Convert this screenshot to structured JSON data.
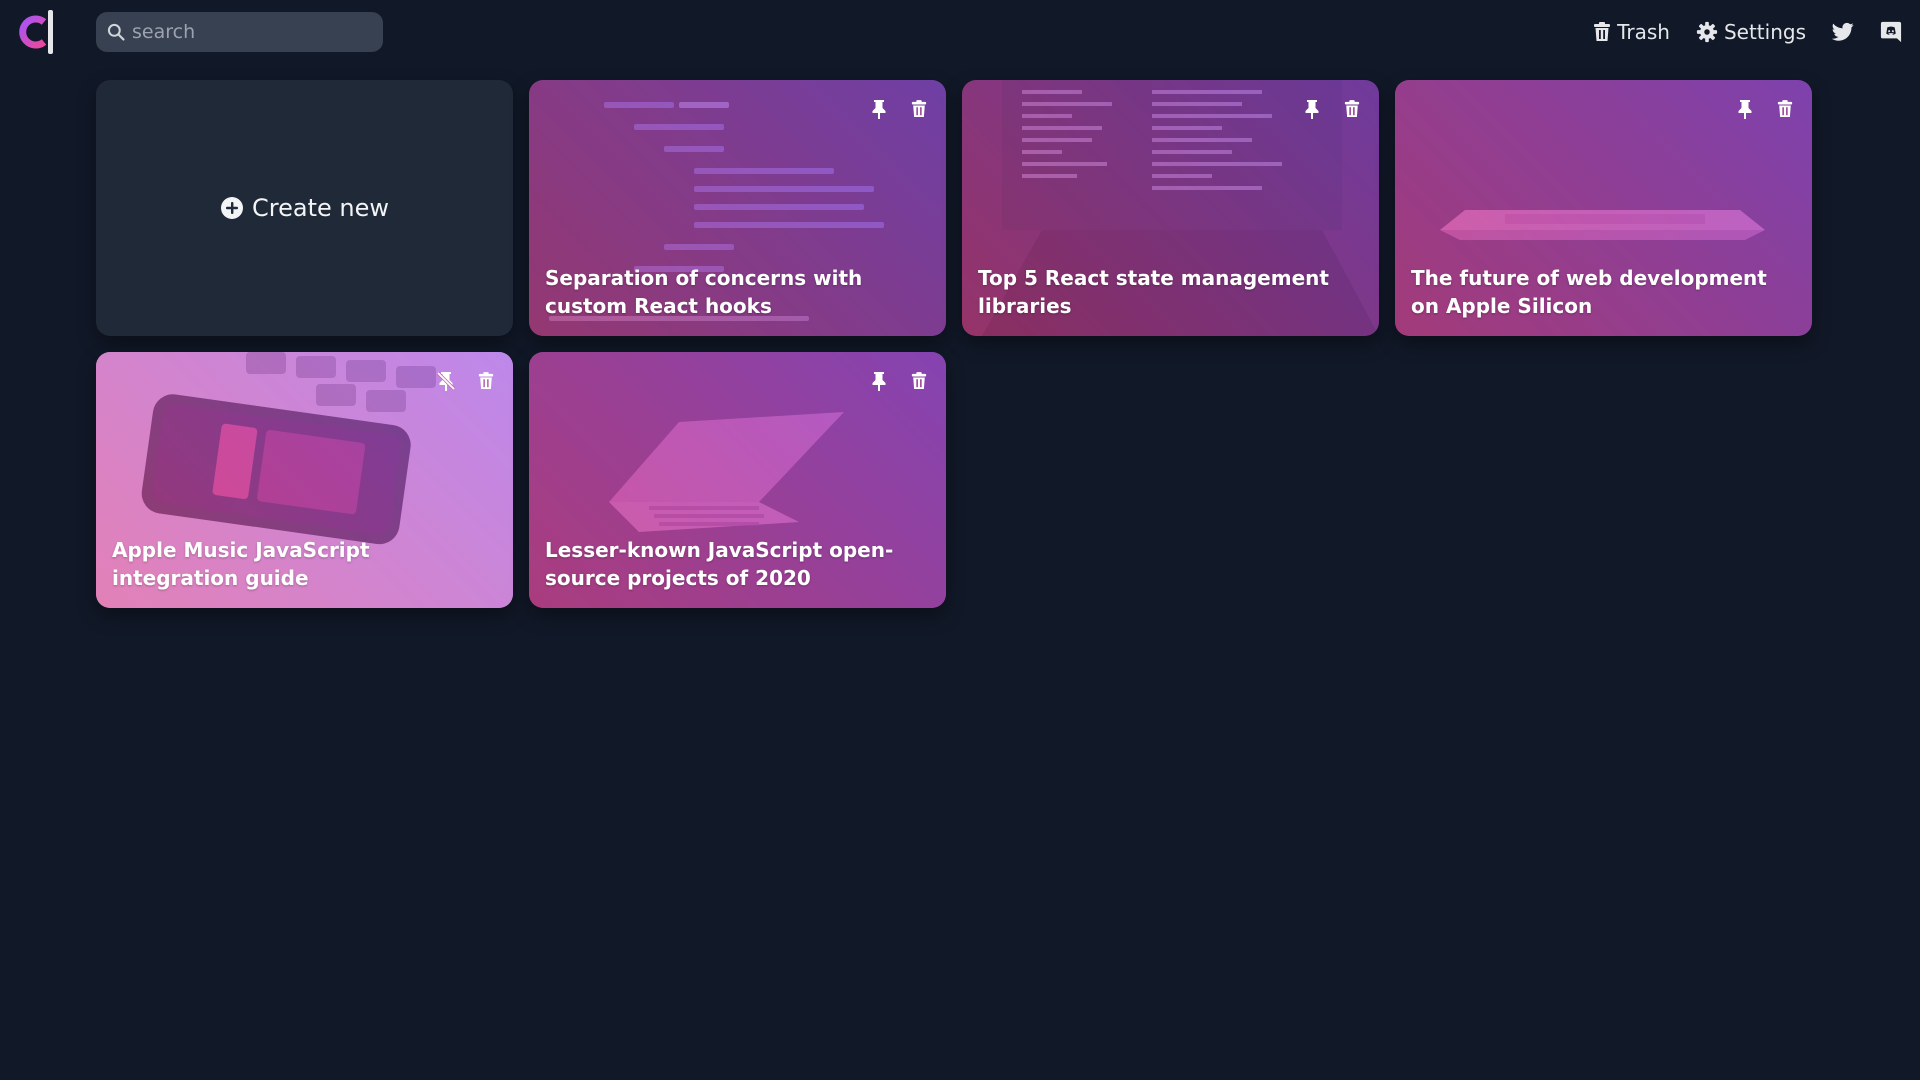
{
  "app": {
    "logo_icon": "c-logo-icon",
    "accent_pink": "#ec4899",
    "accent_purple": "#a855f7",
    "background": "#111827"
  },
  "search": {
    "placeholder": "search",
    "value": "",
    "icon": "search-icon"
  },
  "nav": {
    "trash_label": "Trash",
    "settings_label": "Settings",
    "twitter_icon": "twitter-icon",
    "discord_icon": "discord-icon"
  },
  "create": {
    "label": "Create new",
    "icon": "plus-circle-icon"
  },
  "cards": [
    {
      "title": "Separation of concerns with custom React hooks",
      "pinned": false,
      "image": "code-editor-image"
    },
    {
      "title": "Top 5 React state management libraries",
      "pinned": false,
      "image": "laptop-code-image"
    },
    {
      "title": "The future of web development on Apple Silicon",
      "pinned": false,
      "image": "macbook-image"
    },
    {
      "title": "Apple Music JavaScript integration guide",
      "pinned": true,
      "image": "iphone-music-image"
    },
    {
      "title": "Lesser-known JavaScript open-source projects of 2020",
      "pinned": false,
      "image": "open-laptop-image"
    }
  ]
}
